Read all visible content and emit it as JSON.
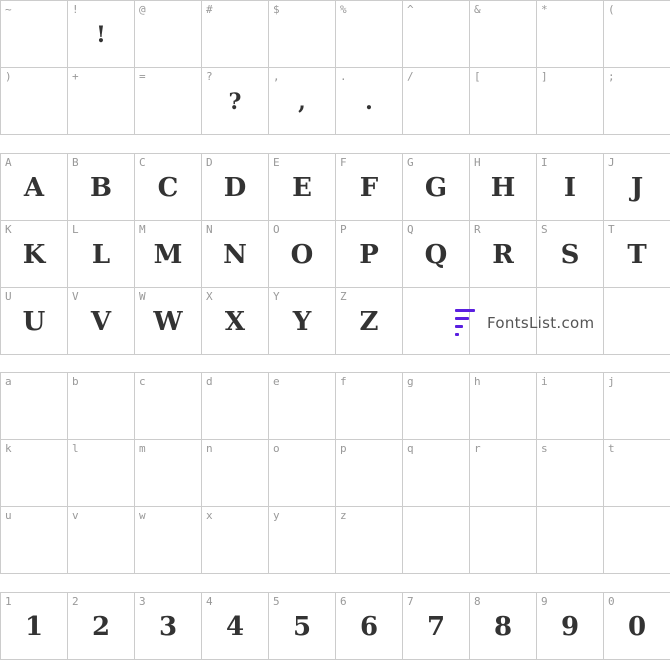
{
  "sections": [
    {
      "id": "punctuation",
      "cells": [
        {
          "key": "~",
          "glyph": ""
        },
        {
          "key": "!",
          "glyph": "!"
        },
        {
          "key": "@",
          "glyph": ""
        },
        {
          "key": "#",
          "glyph": ""
        },
        {
          "key": "$",
          "glyph": ""
        },
        {
          "key": "%",
          "glyph": ""
        },
        {
          "key": "^",
          "glyph": ""
        },
        {
          "key": "&",
          "glyph": ""
        },
        {
          "key": "*",
          "glyph": ""
        },
        {
          "key": "(",
          "glyph": ""
        },
        {
          "key": ")",
          "glyph": ""
        },
        {
          "key": "+",
          "glyph": ""
        },
        {
          "key": "=",
          "glyph": ""
        },
        {
          "key": "?",
          "glyph": "?"
        },
        {
          "key": ",",
          "glyph": ","
        },
        {
          "key": ".",
          "glyph": "."
        },
        {
          "key": "/",
          "glyph": ""
        },
        {
          "key": "[",
          "glyph": ""
        },
        {
          "key": "]",
          "glyph": ""
        },
        {
          "key": ";",
          "glyph": ""
        }
      ]
    },
    {
      "id": "uppercase",
      "cells": [
        {
          "key": "A",
          "glyph": "A"
        },
        {
          "key": "B",
          "glyph": "B"
        },
        {
          "key": "C",
          "glyph": "C"
        },
        {
          "key": "D",
          "glyph": "D"
        },
        {
          "key": "E",
          "glyph": "E"
        },
        {
          "key": "F",
          "glyph": "F"
        },
        {
          "key": "G",
          "glyph": "G"
        },
        {
          "key": "H",
          "glyph": "H"
        },
        {
          "key": "I",
          "glyph": "I"
        },
        {
          "key": "J",
          "glyph": "J"
        },
        {
          "key": "K",
          "glyph": "K"
        },
        {
          "key": "L",
          "glyph": "L"
        },
        {
          "key": "M",
          "glyph": "M"
        },
        {
          "key": "N",
          "glyph": "N"
        },
        {
          "key": "O",
          "glyph": "O"
        },
        {
          "key": "P",
          "glyph": "P"
        },
        {
          "key": "Q",
          "glyph": "Q"
        },
        {
          "key": "R",
          "glyph": "R"
        },
        {
          "key": "S",
          "glyph": "S"
        },
        {
          "key": "T",
          "glyph": "T"
        },
        {
          "key": "U",
          "glyph": "U"
        },
        {
          "key": "V",
          "glyph": "V"
        },
        {
          "key": "W",
          "glyph": "W"
        },
        {
          "key": "X",
          "glyph": "X"
        },
        {
          "key": "Y",
          "glyph": "Y"
        },
        {
          "key": "Z",
          "glyph": "Z"
        },
        {
          "key": "",
          "glyph": ""
        },
        {
          "key": "",
          "glyph": ""
        },
        {
          "key": "",
          "glyph": ""
        },
        {
          "key": "",
          "glyph": ""
        }
      ]
    },
    {
      "id": "lowercase",
      "cells": [
        {
          "key": "a",
          "glyph": ""
        },
        {
          "key": "b",
          "glyph": ""
        },
        {
          "key": "c",
          "glyph": ""
        },
        {
          "key": "d",
          "glyph": ""
        },
        {
          "key": "e",
          "glyph": ""
        },
        {
          "key": "f",
          "glyph": ""
        },
        {
          "key": "g",
          "glyph": ""
        },
        {
          "key": "h",
          "glyph": ""
        },
        {
          "key": "i",
          "glyph": ""
        },
        {
          "key": "j",
          "glyph": ""
        },
        {
          "key": "k",
          "glyph": ""
        },
        {
          "key": "l",
          "glyph": ""
        },
        {
          "key": "m",
          "glyph": ""
        },
        {
          "key": "n",
          "glyph": ""
        },
        {
          "key": "o",
          "glyph": ""
        },
        {
          "key": "p",
          "glyph": ""
        },
        {
          "key": "q",
          "glyph": ""
        },
        {
          "key": "r",
          "glyph": ""
        },
        {
          "key": "s",
          "glyph": ""
        },
        {
          "key": "t",
          "glyph": ""
        },
        {
          "key": "u",
          "glyph": ""
        },
        {
          "key": "v",
          "glyph": ""
        },
        {
          "key": "w",
          "glyph": ""
        },
        {
          "key": "x",
          "glyph": ""
        },
        {
          "key": "y",
          "glyph": ""
        },
        {
          "key": "z",
          "glyph": ""
        },
        {
          "key": "",
          "glyph": ""
        },
        {
          "key": "",
          "glyph": ""
        },
        {
          "key": "",
          "glyph": ""
        },
        {
          "key": "",
          "glyph": ""
        }
      ]
    },
    {
      "id": "digits",
      "cells": [
        {
          "key": "1",
          "glyph": "1"
        },
        {
          "key": "2",
          "glyph": "2"
        },
        {
          "key": "3",
          "glyph": "3"
        },
        {
          "key": "4",
          "glyph": "4"
        },
        {
          "key": "5",
          "glyph": "5"
        },
        {
          "key": "6",
          "glyph": "6"
        },
        {
          "key": "7",
          "glyph": "7"
        },
        {
          "key": "8",
          "glyph": "8"
        },
        {
          "key": "9",
          "glyph": "9"
        },
        {
          "key": "0",
          "glyph": "0"
        }
      ]
    }
  ],
  "watermark": {
    "text": "FontsList.com",
    "accent_color": "#5a1fe0"
  },
  "colors": {
    "grid_line": "#cccccc",
    "key_text": "#999999",
    "glyph": "#333333"
  }
}
